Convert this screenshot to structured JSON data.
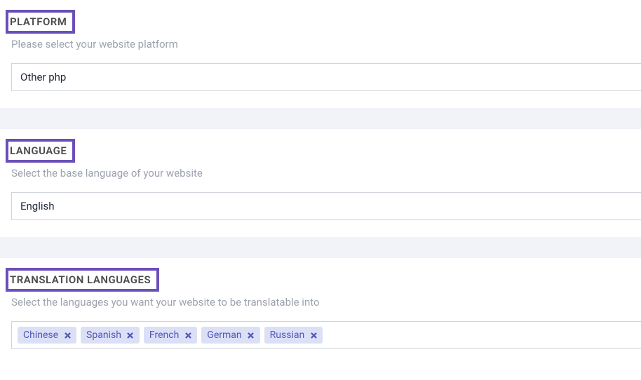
{
  "platform": {
    "title": "PLATFORM",
    "subtitle": "Please select your website platform",
    "value": "Other php"
  },
  "language": {
    "title": "LANGUAGE",
    "subtitle": "Select the base language of your website",
    "value": "English"
  },
  "translation": {
    "title": "TRANSLATION LANGUAGES",
    "subtitle": "Select the languages you want your website to be translatable into",
    "tags": [
      "Chinese",
      "Spanish",
      "French",
      "German",
      "Russian"
    ]
  }
}
